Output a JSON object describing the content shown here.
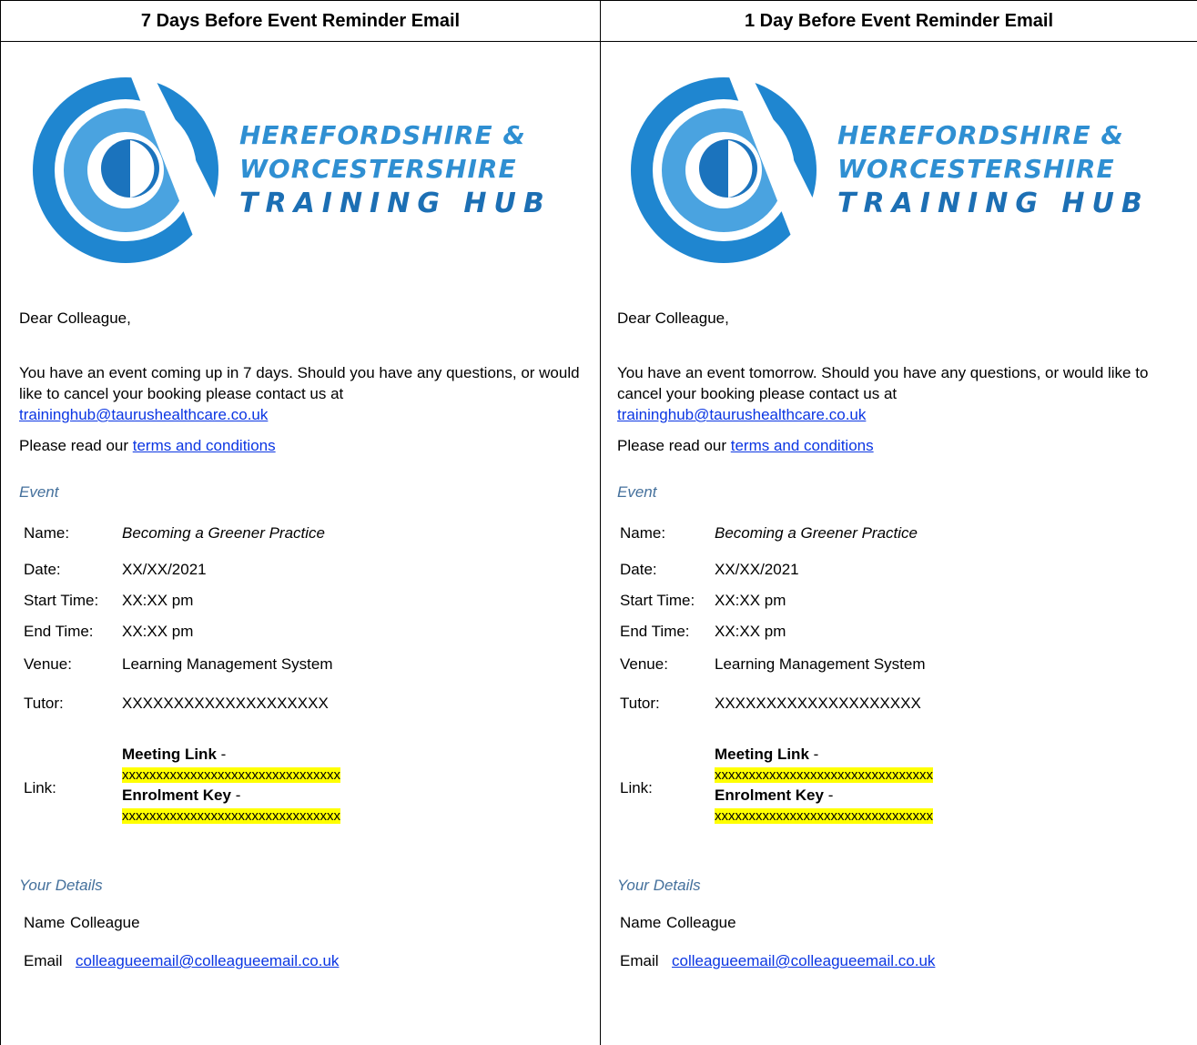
{
  "columns": [
    {
      "header": "7 Days Before Event Reminder Email",
      "logo": {
        "line1": "HEREFORDSHIRE &",
        "line2": "WORCESTERSHIRE",
        "line3": "TRAINING HUB"
      },
      "greeting": "Dear Colleague,",
      "body_text": "You have an event coming up in 7 days. Should you have any questions, or would like to cancel your booking please contact us at",
      "contact_email": "traininghub@taurushealthcare.co.uk",
      "terms_prefix": "Please read our ",
      "terms_link": "terms and conditions",
      "event_heading": "Event",
      "event": {
        "name_label": "Name:",
        "name_value": "Becoming a Greener Practice",
        "date_label": "Date:",
        "date_value": "XX/XX/2021",
        "start_label": "Start Time:",
        "start_value": "XX:XX pm",
        "end_label": "End Time:",
        "end_value": "XX:XX pm",
        "venue_label": "Venue:",
        "venue_value": "Learning Management System",
        "tutor_label": "Tutor:",
        "tutor_value": "XXXXXXXXXXXXXXXXXXXX",
        "link_label": "Link:",
        "meeting_link_label": "Meeting Link",
        "meeting_link_sep": " -",
        "meeting_link_value": "xxxxxxxxxxxxxxxxxxxxxxxxxxxxxxxx",
        "enrolment_label": "Enrolment Key",
        "enrolment_sep": " -",
        "enrolment_value": "xxxxxxxxxxxxxxxxxxxxxxxxxxxxxxxx"
      },
      "details_heading": "Your Details",
      "details": {
        "name_label": "Name",
        "name_value": "Colleague",
        "email_label": "Email",
        "email_value": "colleagueemail@colleagueemail.co.uk"
      }
    },
    {
      "header": "1 Day Before Event Reminder Email",
      "logo": {
        "line1": "HEREFORDSHIRE &",
        "line2": "WORCESTERSHIRE",
        "line3": "TRAINING HUB"
      },
      "greeting": "Dear Colleague,",
      "body_text": "You have an event tomorrow. Should you have any questions, or would like to cancel your booking please contact us at",
      "contact_email": "traininghub@taurushealthcare.co.uk",
      "terms_prefix": "Please read our ",
      "terms_link": "terms and conditions",
      "event_heading": "Event",
      "event": {
        "name_label": "Name:",
        "name_value": "Becoming a Greener Practice",
        "date_label": "Date:",
        "date_value": "XX/XX/2021",
        "start_label": "Start Time:",
        "start_value": "XX:XX pm",
        "end_label": "End Time:",
        "end_value": "XX:XX pm",
        "venue_label": "Venue:",
        "venue_value": "Learning Management System",
        "tutor_label": "Tutor:",
        "tutor_value": "XXXXXXXXXXXXXXXXXXXX",
        "link_label": "Link:",
        "meeting_link_label": "Meeting Link",
        "meeting_link_sep": " -",
        "meeting_link_value": "xxxxxxxxxxxxxxxxxxxxxxxxxxxxxxxx",
        "enrolment_label": "Enrolment Key",
        "enrolment_sep": " -",
        "enrolment_value": "xxxxxxxxxxxxxxxxxxxxxxxxxxxxxxxx"
      },
      "details_heading": "Your Details",
      "details": {
        "name_label": "Name",
        "name_value": "Colleague",
        "email_label": "Email",
        "email_value": "colleagueemail@colleagueemail.co.uk"
      }
    }
  ],
  "colors": {
    "logo_blue": "#2f8fd2",
    "link_blue": "#0b36e3",
    "section_heading": "#44709c",
    "highlight": "#ffff00"
  }
}
